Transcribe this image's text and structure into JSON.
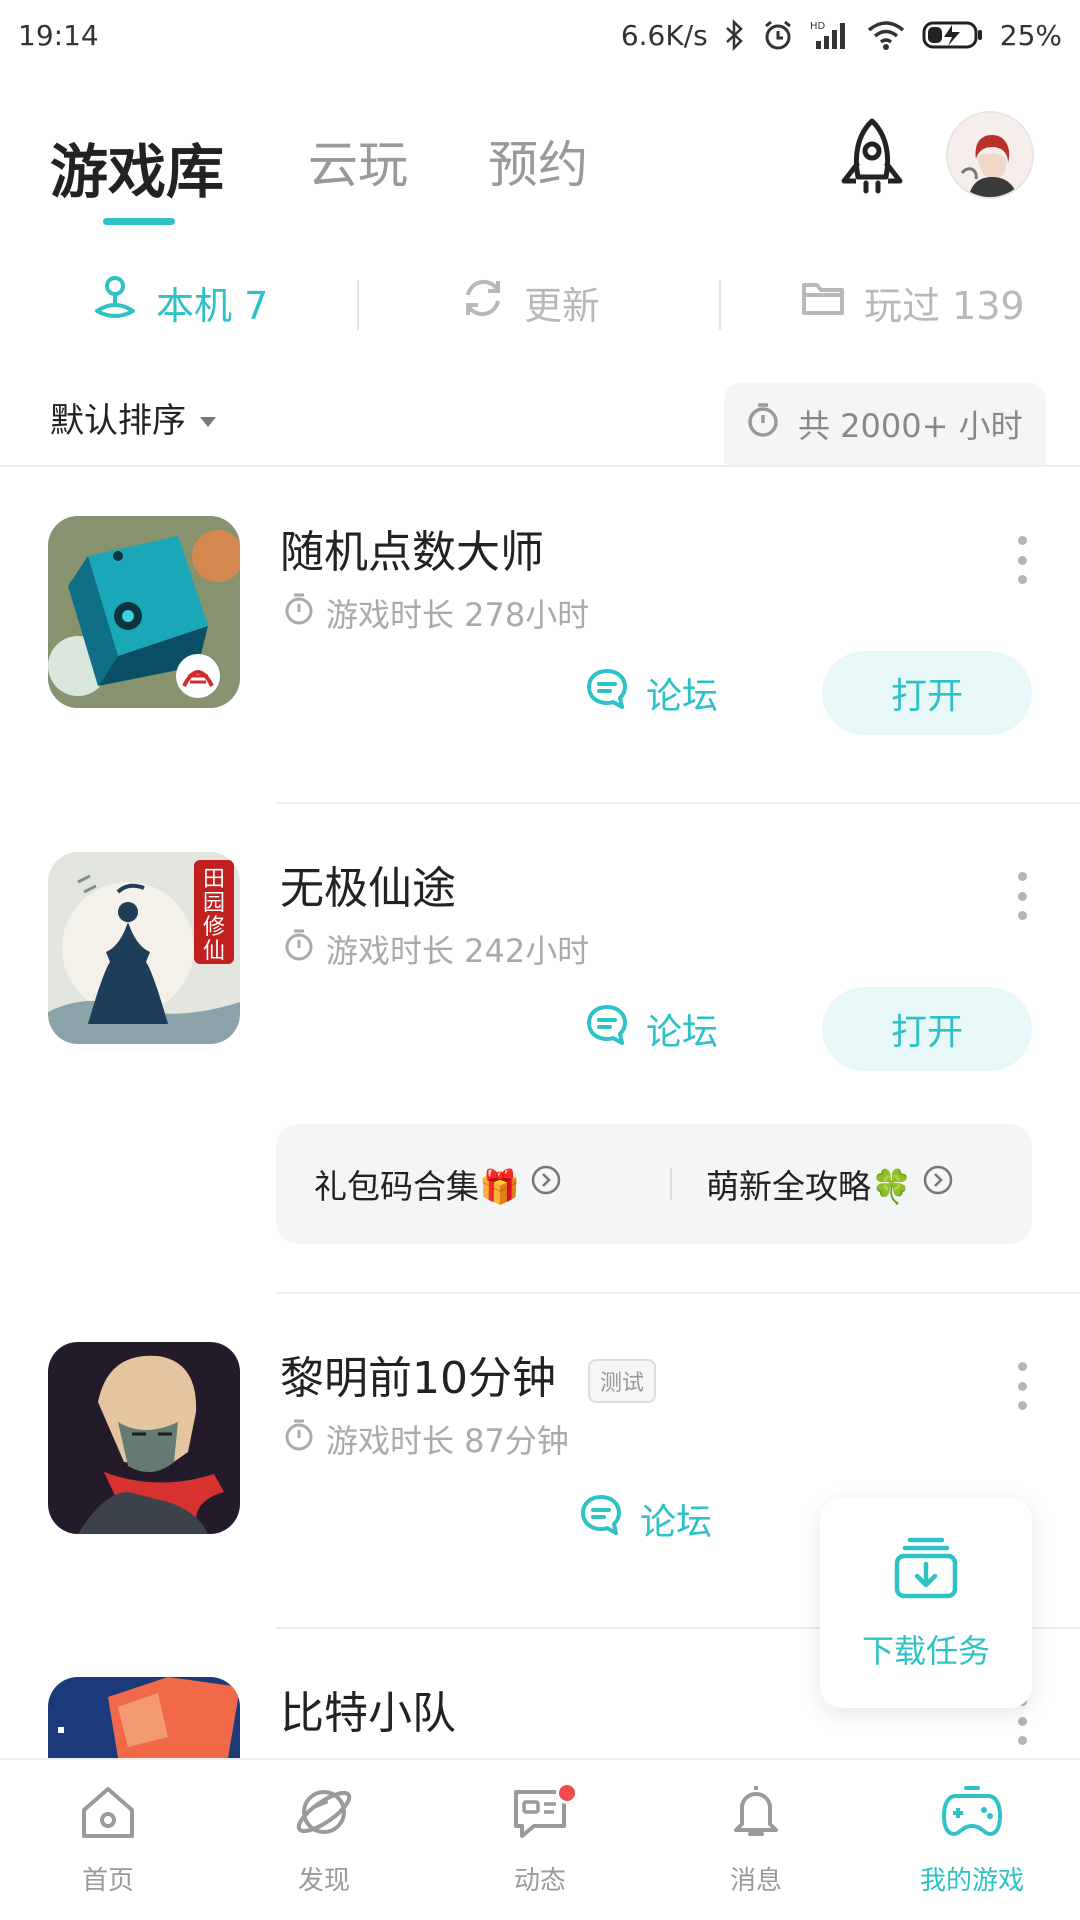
{
  "status_bar": {
    "time": "19:14",
    "net_speed": "6.6K/s",
    "battery": "25%",
    "icons": [
      "bluetooth-icon",
      "alarm-icon",
      "signal-hd-icon",
      "wifi-icon",
      "battery-charging-icon"
    ]
  },
  "header": {
    "tabs": [
      {
        "label": "游戏库",
        "active": true
      },
      {
        "label": "云玩",
        "active": false
      },
      {
        "label": "预约",
        "active": false
      }
    ],
    "rocket_icon": "rocket-icon",
    "avatar": "avatar"
  },
  "filters": [
    {
      "label": "本机 7",
      "icon": "joystick-icon",
      "active": true
    },
    {
      "label": "更新",
      "icon": "refresh-icon",
      "active": false
    },
    {
      "label": "玩过 139",
      "icon": "folder-icon",
      "active": false
    }
  ],
  "sort": {
    "label": "默认排序",
    "total_playtime": "共 2000+ 小时"
  },
  "games": [
    {
      "title": "随机点数大师",
      "tag": "",
      "playtime": "游戏时长 278小时",
      "forum_label": "论坛",
      "open_label": "打开"
    },
    {
      "title": "无极仙途",
      "tag": "",
      "playtime": "游戏时长 242小时",
      "forum_label": "论坛",
      "open_label": "打开",
      "promo": [
        {
          "label": "礼包码合集🎁"
        },
        {
          "label": "萌新全攻略🍀"
        }
      ]
    },
    {
      "title": "黎明前10分钟",
      "tag": "测试",
      "playtime": "游戏时长 87分钟",
      "forum_label": "论坛",
      "open_label": ""
    },
    {
      "title": "比特小队",
      "tag": "",
      "playtime": "",
      "forum_label": "",
      "open_label": ""
    }
  ],
  "download_task": {
    "label": "下载任务"
  },
  "bottom_nav": [
    {
      "label": "首页",
      "icon": "home-icon",
      "active": false
    },
    {
      "label": "发现",
      "icon": "planet-icon",
      "active": false
    },
    {
      "label": "动态",
      "icon": "chat-icon",
      "active": false,
      "badge": true
    },
    {
      "label": "消息",
      "icon": "bell-icon",
      "active": false
    },
    {
      "label": "我的游戏",
      "icon": "gamepad-icon",
      "active": true
    }
  ],
  "colors": {
    "accent": "#2ec1c5",
    "text": "#222222",
    "muted": "#aaaaaa",
    "badge": "#f04b4b"
  }
}
